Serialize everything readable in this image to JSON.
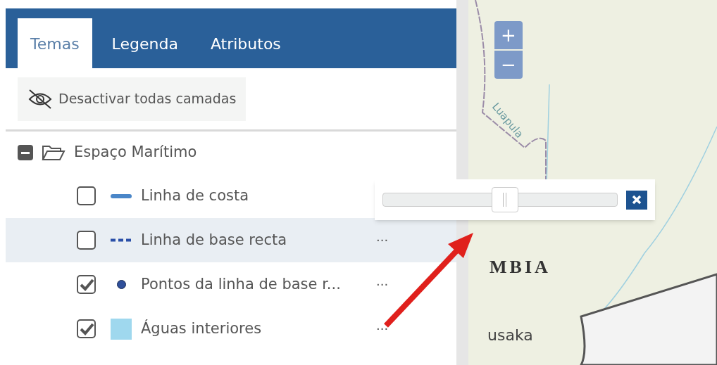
{
  "tabs": [
    {
      "label": "Temas",
      "selected": true
    },
    {
      "label": "Legenda",
      "selected": false
    },
    {
      "label": "Atributos",
      "selected": false
    }
  ],
  "toolbar": {
    "button": "Desactivar todas camadas"
  },
  "tree": {
    "group": {
      "label": "Espaço Marítimo",
      "expanded": true,
      "children": [
        {
          "label": "Linha de costa",
          "checked": false,
          "selected": false,
          "kind": "line",
          "color": "#4a86c8"
        },
        {
          "label": "Linha de base recta",
          "checked": false,
          "selected": true,
          "kind": "dashed",
          "color": "#2a4fa8",
          "menu": "···"
        },
        {
          "label": "Pontos da linha de base r...",
          "checked": true,
          "selected": false,
          "kind": "dot",
          "color": "#2f4f9a",
          "menu": "···"
        },
        {
          "label": "Águas interiores",
          "checked": true,
          "selected": false,
          "kind": "fill",
          "color": "#9fd8ee",
          "menu": "···"
        }
      ]
    }
  },
  "map": {
    "zoom_in": "+",
    "zoom_out": "−",
    "labels": [
      {
        "text": "Luapula",
        "kind": "river"
      },
      {
        "text": "MBIA",
        "kind": "country"
      },
      {
        "text": "usaka",
        "kind": "city"
      }
    ],
    "opacity_popup": {
      "level": 0.52
    }
  }
}
